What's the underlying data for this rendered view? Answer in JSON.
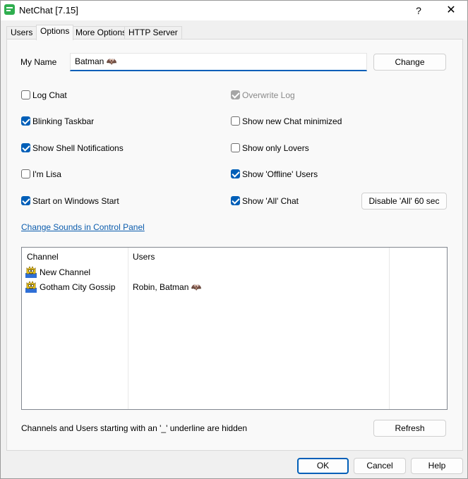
{
  "window": {
    "title": "NetChat [7.15]",
    "help_glyph": "?",
    "close_glyph": "✕"
  },
  "tabs": [
    {
      "label": "Users"
    },
    {
      "label": "Options"
    },
    {
      "label": "More Options"
    },
    {
      "label": "HTTP Server"
    }
  ],
  "active_tab": "Options",
  "my_name": {
    "label": "My Name",
    "value": "Batman 🦇",
    "change_button": "Change"
  },
  "options_left": [
    {
      "label": "Log Chat",
      "checked": false
    },
    {
      "label": "Blinking Taskbar",
      "checked": true
    },
    {
      "label": "Show Shell Notifications",
      "checked": true
    },
    {
      "label": "I'm Lisa",
      "checked": false
    },
    {
      "label": "Start on Windows Start",
      "checked": true
    }
  ],
  "options_right": [
    {
      "label": "Overwrite Log",
      "checked": true,
      "disabled": true
    },
    {
      "label": "Show new Chat minimized",
      "checked": false
    },
    {
      "label": "Show only Lovers",
      "checked": false
    },
    {
      "label": "Show 'Offline' Users",
      "checked": true
    },
    {
      "label": "Show 'All' Chat",
      "checked": true
    }
  ],
  "disable_all_button": "Disable 'All' 60 sec",
  "sounds_link": "Change Sounds in Control Panel",
  "channel_list": {
    "headers": {
      "channel": "Channel",
      "users": "Users"
    },
    "rows": [
      {
        "channel": "New Channel",
        "users": ""
      },
      {
        "channel": "Gotham City Gossip",
        "users": "Robin, Batman 🦇"
      }
    ]
  },
  "hidden_note": "Channels and Users starting with an '_' underline are hidden",
  "refresh_button": "Refresh",
  "footer": {
    "ok": "OK",
    "cancel": "Cancel",
    "help": "Help"
  },
  "colors": {
    "accent": "#005fb8",
    "link": "#0b5cad",
    "dialog_bg": "#f0f0f0"
  }
}
